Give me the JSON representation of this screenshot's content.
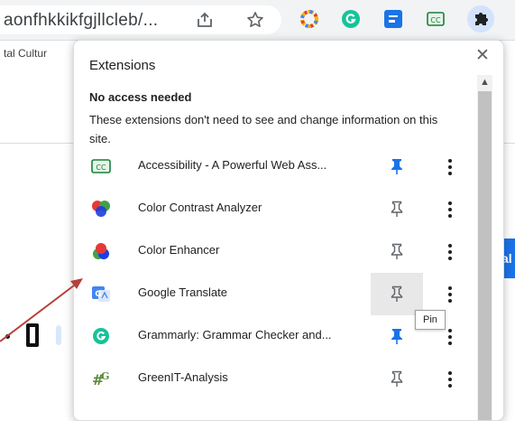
{
  "browser": {
    "url_text": "aonfhkkikfgjllcleb/...",
    "bookmark_text": "tal Cultur"
  },
  "page": {
    "right_edge_text": "n",
    "button_text": "al"
  },
  "popup": {
    "title": "Extensions",
    "close_glyph": "✕",
    "section_heading": "No access needed",
    "section_description": "These extensions don't need to see and change information on this site.",
    "items": [
      {
        "name": "Accessibility - A Powerful Web Ass...",
        "icon": "accessibility-cc-icon",
        "pinned": true
      },
      {
        "name": "Color Contrast Analyzer",
        "icon": "color-contrast-icon",
        "pinned": false
      },
      {
        "name": "Color Enhancer",
        "icon": "color-enhancer-icon",
        "pinned": false
      },
      {
        "name": "Google Translate",
        "icon": "google-translate-icon",
        "pinned": false
      },
      {
        "name": "Grammarly: Grammar Checker and...",
        "icon": "grammarly-icon",
        "pinned": true
      },
      {
        "name": "GreenIT-Analysis",
        "icon": "greenit-icon",
        "pinned": false
      }
    ],
    "tooltip": "Pin"
  },
  "colors": {
    "pin_active": "#1a73e8",
    "pin_inactive": "#5f6368",
    "annotation_arrow": "#b5403a"
  }
}
